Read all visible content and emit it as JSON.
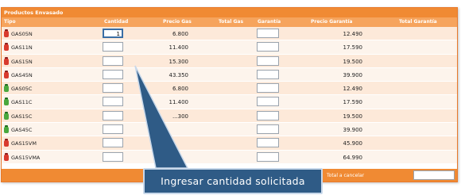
{
  "panel": {
    "title": "Productos Envasado"
  },
  "columns": {
    "tipo": "Tipo",
    "cantidad": "Cantidad",
    "precio_gas": "Precio Gas",
    "total_gas": "Total Gas",
    "garantia": "Garantía",
    "precio_garantia": "Precio Garantía",
    "total_garantia": "Total Garantía"
  },
  "rows": [
    {
      "sku": "GAS05N",
      "icon": "gas-cylinder-red-icon",
      "quantity": "1",
      "precio_gas": "6.800",
      "precio_garantia": "12.490"
    },
    {
      "sku": "GAS11N",
      "icon": "gas-cylinder-red-icon",
      "quantity": "",
      "precio_gas": "11.400",
      "precio_garantia": "17.590"
    },
    {
      "sku": "GAS15N",
      "icon": "gas-cylinder-red-icon",
      "quantity": "",
      "precio_gas": "15.300",
      "precio_garantia": "19.500"
    },
    {
      "sku": "GAS45N",
      "icon": "gas-cylinder-red-icon",
      "quantity": "",
      "precio_gas": "43.350",
      "precio_garantia": "39.900"
    },
    {
      "sku": "GAS05C",
      "icon": "gas-cylinder-green-icon",
      "quantity": "",
      "precio_gas": "6.800",
      "precio_garantia": "12.490"
    },
    {
      "sku": "GAS11C",
      "icon": "gas-cylinder-green-icon",
      "quantity": "",
      "precio_gas": "11.400",
      "precio_garantia": "17.590"
    },
    {
      "sku": "GAS15C",
      "icon": "gas-cylinder-green-icon",
      "quantity": "",
      "precio_gas": "...300",
      "precio_garantia": "19.500"
    },
    {
      "sku": "GAS45C",
      "icon": "gas-cylinder-green-icon",
      "quantity": "",
      "precio_gas": "",
      "precio_garantia": "39.900"
    },
    {
      "sku": "GAS15VM",
      "icon": "gas-cylinder-red-icon",
      "quantity": "",
      "precio_gas": "",
      "precio_garantia": "45.900"
    },
    {
      "sku": "GAS15VMA",
      "icon": "gas-cylinder-red-icon",
      "quantity": "",
      "precio_gas": "",
      "precio_garantia": "64.990"
    }
  ],
  "footer": {
    "total_label": "Total a cancelar"
  },
  "callout": {
    "text": "Ingresar cantidad solicitada"
  },
  "colors": {
    "header_orange": "#f08a33",
    "row_light": "#fde9d9",
    "callout_blue": "#2f5b86"
  }
}
